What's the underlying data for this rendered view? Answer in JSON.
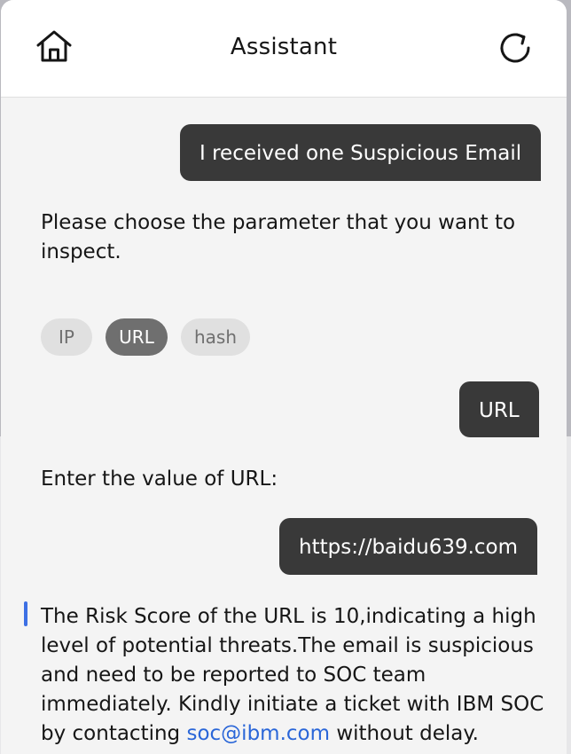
{
  "header": {
    "title": "Assistant",
    "home_icon": "home-icon",
    "refresh_icon": "refresh-icon"
  },
  "messages": {
    "user_1": "I received one Suspicious Email",
    "bot_1": "Please choose the parameter that you want to inspect.",
    "options": [
      {
        "label": "IP",
        "selected": false
      },
      {
        "label": "URL",
        "selected": true
      },
      {
        "label": "hash",
        "selected": false
      }
    ],
    "user_2": "URL",
    "bot_2": "Enter the value of URL:",
    "user_3": "https://baidu639.com",
    "bot_3": {
      "text_before": "The Risk Score of the URL is 10,indicating a high level of potential threats.The email is suspicious and need to be reported to SOC team immediately. Kindly initiate a ticket with IBM SOC by contacting ",
      "link": "soc@ibm.com",
      "text_after": " without delay."
    }
  },
  "colors": {
    "user_bubble": "#393939",
    "accent": "#3d70e4",
    "link": "#2a66d8"
  }
}
